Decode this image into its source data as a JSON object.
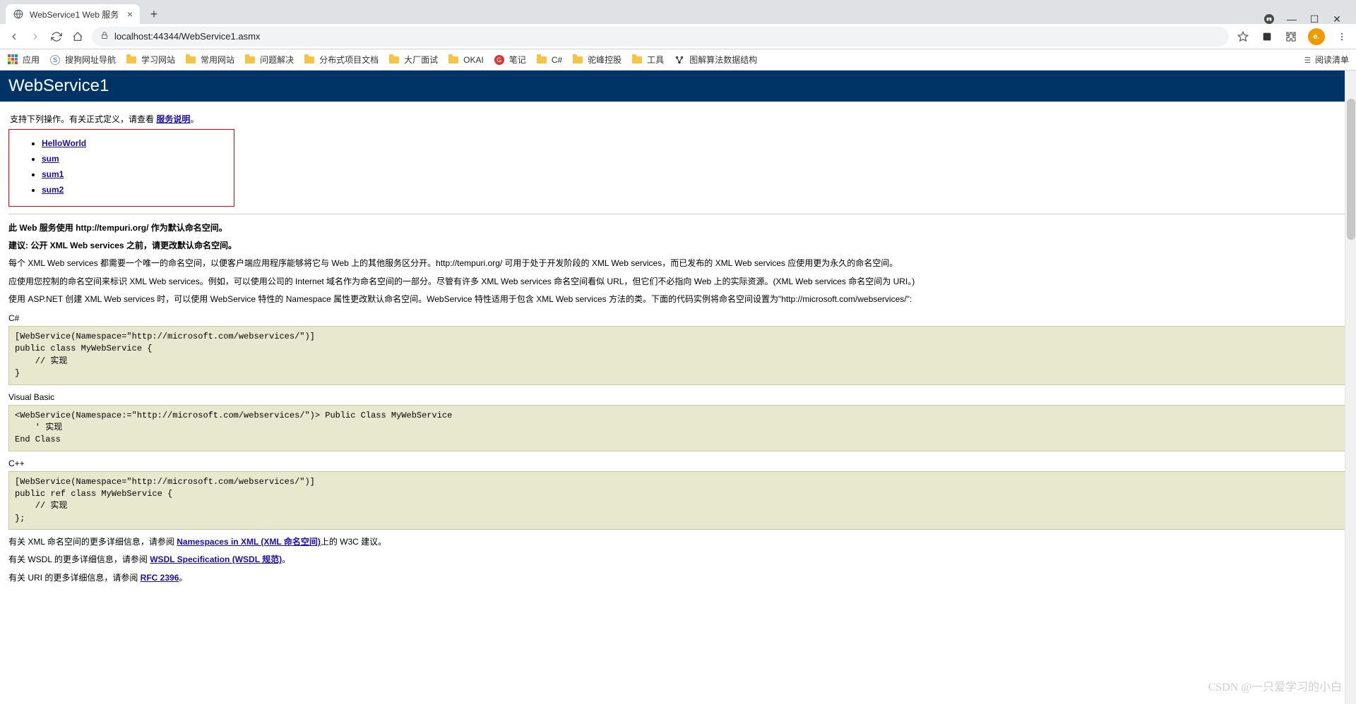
{
  "browser": {
    "tab": {
      "title": "WebService1 Web 服务"
    },
    "url": "localhost:44344/WebService1.asmx",
    "bookmarks": {
      "apps": "应用",
      "items": [
        {
          "label": "搜狗网址导航",
          "icon": "sogou"
        },
        {
          "label": "学习网站",
          "icon": "folder"
        },
        {
          "label": "常用网站",
          "icon": "folder"
        },
        {
          "label": "问题解决",
          "icon": "folder"
        },
        {
          "label": "分布式项目文档",
          "icon": "folder"
        },
        {
          "label": "大厂面试",
          "icon": "folder"
        },
        {
          "label": "OKAI",
          "icon": "folder"
        },
        {
          "label": "笔记",
          "icon": "note"
        },
        {
          "label": "C#",
          "icon": "folder"
        },
        {
          "label": "驼峰控股",
          "icon": "folder"
        },
        {
          "label": "工具",
          "icon": "folder"
        },
        {
          "label": "图解算法数据结构",
          "icon": "graph"
        }
      ],
      "readlist": "阅读清单"
    }
  },
  "page": {
    "title": "WebService1",
    "intro_prefix": "支持下列操作。有关正式定义，请查看",
    "intro_link": "服务说明",
    "intro_suffix": "。",
    "operations": [
      "HelloWorld",
      "sum",
      "sum1",
      "sum2"
    ],
    "ns_heading": "此 Web 服务使用 http://tempuri.org/ 作为默认命名空间。",
    "recommend": "建议: 公开 XML Web services 之前，请更改默认命名空间。",
    "p1": "每个 XML Web services 都需要一个唯一的命名空间，以便客户端应用程序能够将它与 Web 上的其他服务区分开。http://tempuri.org/ 可用于处于开发阶段的 XML Web services，而已发布的 XML Web services 应使用更为永久的命名空间。",
    "p2": "应使用您控制的命名空间来标识 XML Web services。例如，可以使用公司的 Internet 域名作为命名空间的一部分。尽管有许多 XML Web services 命名空间看似 URL，但它们不必指向 Web 上的实际资源。(XML Web services 命名空间为 URI。)",
    "p3": "使用 ASP.NET 创建 XML Web services 时，可以使用 WebService 特性的 Namespace 属性更改默认命名空间。WebService 特性适用于包含 XML Web services 方法的类。下面的代码实例将命名空间设置为\"http://microsoft.com/webservices/\":",
    "code_csharp_label": "C#",
    "code_csharp": "[WebService(Namespace=\"http://microsoft.com/webservices/\")]\npublic class MyWebService {\n    // 实现\n}",
    "code_vb_label": "Visual Basic",
    "code_vb": "<WebService(Namespace:=\"http://microsoft.com/webservices/\")> Public Class MyWebService\n    ' 实现\nEnd Class",
    "code_cpp_label": "C++",
    "code_cpp": "[WebService(Namespace=\"http://microsoft.com/webservices/\")]\npublic ref class MyWebService {\n    // 实现\n};",
    "more_xml_prefix": "有关 XML 命名空间的更多详细信息，请参阅 ",
    "more_xml_link": "Namespaces in XML (XML 命名空间)",
    "more_xml_suffix": "上的 W3C 建议。",
    "more_wsdl_prefix": "有关 WSDL 的更多详细信息，请参阅 ",
    "more_wsdl_link": "WSDL Specification (WSDL 规范)",
    "more_wsdl_suffix": "。",
    "more_uri_prefix": "有关 URI 的更多详细信息，请参阅 ",
    "more_uri_link": "RFC 2396",
    "more_uri_suffix": "。"
  },
  "watermark": "CSDN @一只爱学习的小白"
}
